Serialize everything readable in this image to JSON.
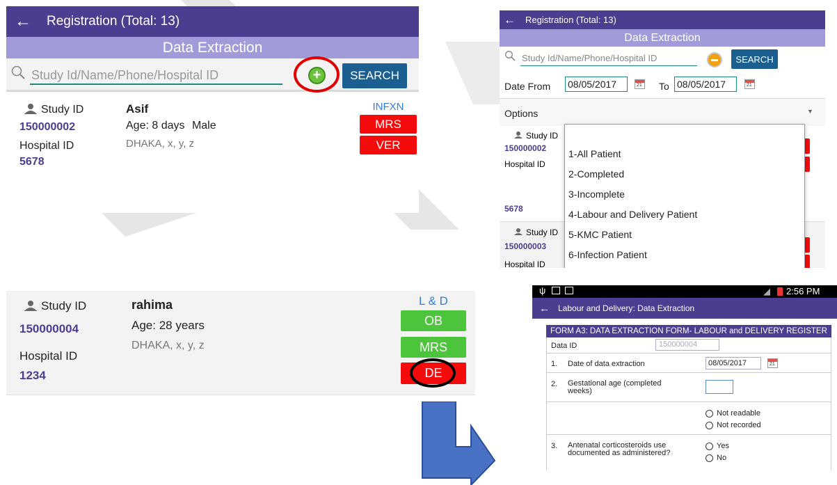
{
  "panel_a": {
    "title": "Registration (Total: 13)",
    "subtitle": "Data Extraction",
    "search_placeholder": "Study Id/Name/Phone/Hospital ID",
    "search_label": "SEARCH",
    "record": {
      "study_id_label": "Study ID",
      "study_id": "150000002",
      "hospital_id_label": "Hospital ID",
      "hospital_id": "5678",
      "name": "Asif",
      "age": "Age: 8 days",
      "sex": "Male",
      "address": "DHAKA, x, y, z",
      "tag": "INFXN",
      "buttons": [
        "MRS",
        "VER"
      ]
    }
  },
  "panel_b": {
    "title": "Registration (Total: 13)",
    "subtitle": "Data Extraction",
    "search_placeholder": "Study Id/Name/Phone/Hospital ID",
    "search_label": "SEARCH",
    "date_from_label": "Date From",
    "date_from": "08/05/2017",
    "to_label": "To",
    "date_to": "08/05/2017",
    "options_label": "Options",
    "dropdown_options": [
      "1-All Patient",
      "2-Completed",
      "3-Incomplete",
      "4-Labour and Delivery Patient",
      "5-KMC Patient",
      "6-Infection Patient"
    ],
    "rows": [
      {
        "study_label": "Study ID",
        "study_id": "150000002",
        "hospital_label": "Hospital ID",
        "hospital_id": "5678"
      },
      {
        "study_label": "Study ID",
        "study_id": "150000003",
        "hospital_label": "Hospital ID"
      }
    ]
  },
  "panel_c": {
    "record": {
      "study_id_label": "Study ID",
      "study_id": "150000004",
      "hospital_id_label": "Hospital ID",
      "hospital_id": "1234",
      "name": "rahima",
      "age": "Age: 28 years",
      "address": "DHAKA, x, y, z",
      "tag": "L & D",
      "buttons": [
        "OB",
        "MRS",
        "DE"
      ]
    }
  },
  "panel_d": {
    "status_time": "2:56 PM",
    "title": "Labour and Delivery: Data Extraction",
    "form_heading": "FORM A3: DATA EXTRACTION FORM- LABOUR and DELIVERY REGISTER",
    "data_id_label": "Data ID",
    "data_id": "150000004",
    "q1_num": "1.",
    "q1": "Date of data extraction",
    "q1_value": "08/05/2017",
    "q2_num": "2.",
    "q2": "Gestational age (completed weeks)",
    "q2_opt1": "Not readable",
    "q2_opt2": "Not recorded",
    "q3_num": "3.",
    "q3": "Antenatal corticosteroids use documented as administered?",
    "q3_opt1": "Yes",
    "q3_opt2": "No"
  },
  "colors": {
    "topbar": "#4b3d8f",
    "subbar": "#a19bd9",
    "red_button": "#f40c0c",
    "green_button": "#4cc43c",
    "link_blue": "#2f7de1",
    "search_button": "#1a5f8f",
    "highlight_ring": "#e00000",
    "arrow": "#4a72c4"
  }
}
